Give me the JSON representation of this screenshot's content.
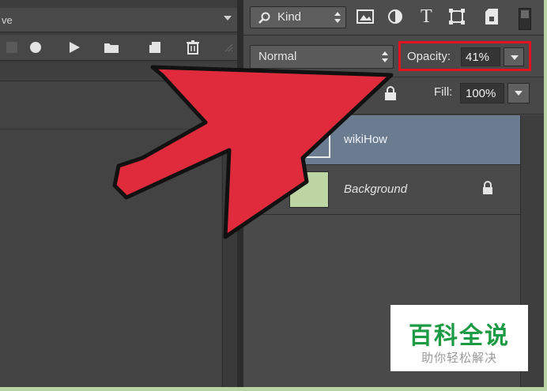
{
  "actions_panel": {
    "action_name": "ve",
    "toolbar_icons": [
      "stop-icon",
      "record-icon",
      "play-icon",
      "folder-icon",
      "new-action-icon",
      "trash-icon"
    ]
  },
  "layers_panel": {
    "filter": {
      "label": "Kind",
      "icons": [
        "image-filter-icon",
        "adjustment-filter-icon",
        "type-filter-icon",
        "shape-filter-icon",
        "smart-object-filter-icon"
      ]
    },
    "blend_mode": "Normal",
    "opacity": {
      "label": "Opacity:",
      "value": "41%"
    },
    "fill": {
      "label": "Fill:",
      "value": "100%"
    },
    "layers": [
      {
        "name": "wikiHow",
        "selected": true
      },
      {
        "name": "Background",
        "locked": true
      }
    ]
  },
  "watermark": {
    "title": "百科全说",
    "subtitle": "助你轻松解决"
  },
  "colors": {
    "highlight_box": "#e0131e",
    "arrow": "#df2b3c",
    "selected_layer": "#6b7b90",
    "background_thumb": "#bcd5a3",
    "watermark_green": "#1c9a44"
  }
}
